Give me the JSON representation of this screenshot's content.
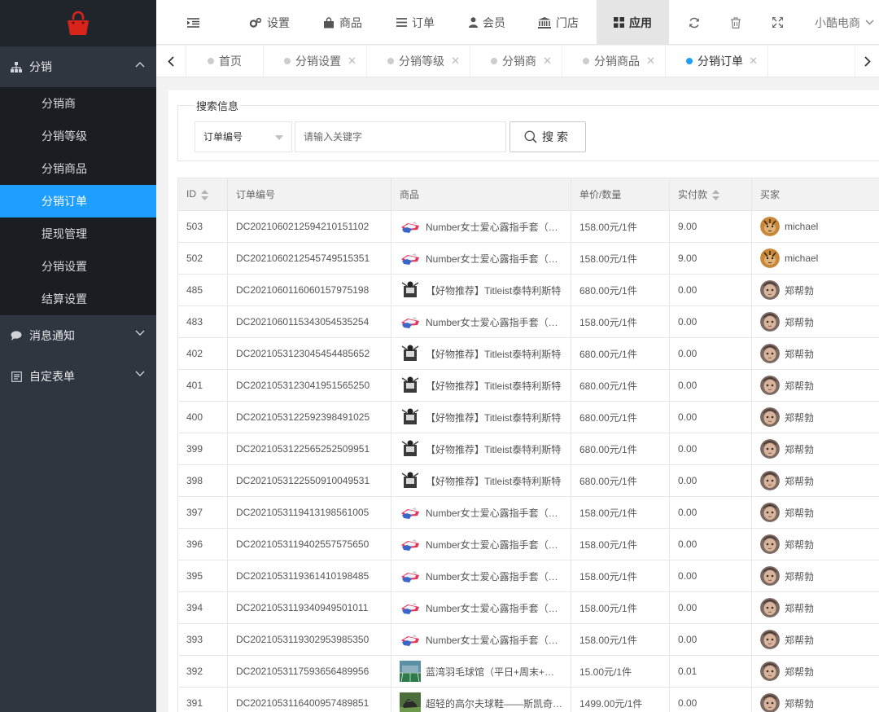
{
  "sidebar": {
    "groups": [
      {
        "label": "分销",
        "icon": "sitemap-icon",
        "expanded": true
      },
      {
        "label": "消息通知",
        "icon": "comment-icon",
        "expanded": false
      },
      {
        "label": "自定表单",
        "icon": "form-icon",
        "expanded": false
      }
    ],
    "items": [
      "分销商",
      "分销等级",
      "分销商品",
      "分销订单",
      "提现管理",
      "分销设置",
      "结算设置"
    ],
    "active_item": "分销订单"
  },
  "topnav": {
    "items": [
      {
        "label": "设置",
        "icon": "gears-icon"
      },
      {
        "label": "商品",
        "icon": "bag-icon"
      },
      {
        "label": "订单",
        "icon": "list-icon"
      },
      {
        "label": "会员",
        "icon": "user-icon"
      },
      {
        "label": "门店",
        "icon": "bank-icon"
      },
      {
        "label": "应用",
        "icon": "grid-icon"
      }
    ],
    "active": "应用",
    "shop_name": "小酷电商"
  },
  "tabs": [
    {
      "label": "首页",
      "closable": false
    },
    {
      "label": "分销设置",
      "closable": true
    },
    {
      "label": "分销等级",
      "closable": true
    },
    {
      "label": "分销商",
      "closable": true
    },
    {
      "label": "分销商品",
      "closable": true
    },
    {
      "label": "分销订单",
      "closable": true,
      "active": true
    }
  ],
  "search": {
    "legend": "搜索信息",
    "select_value": "订单编号",
    "keyword_placeholder": "请输入关键字",
    "button_label": "搜 索"
  },
  "table": {
    "headers": {
      "id": "ID",
      "order_no": "订单编号",
      "goods": "商品",
      "price_qty": "单价/数量",
      "paid": "实付款",
      "buyer": "买家"
    },
    "rows": [
      {
        "id": "503",
        "order_no": "DC20210602125942101511 02",
        "goods": "Number女士爱心露指手套（…",
        "thumb": "glove",
        "price_qty": "158.00元 / 1件",
        "paid": "9.00",
        "buyer": "michael",
        "avatar": "tiger"
      },
      {
        "id": "502",
        "order_no": "DC20210602125457495153 51",
        "goods": "Number女士爱心露指手套（…",
        "thumb": "glove",
        "price_qty": "158.00元 / 1件",
        "paid": "9.00",
        "buyer": "michael",
        "avatar": "tiger"
      },
      {
        "id": "485",
        "order_no": "DC20210601160601579751 98",
        "goods": "【好物推荐】Titleist泰特利斯特",
        "thumb": "golf",
        "price_qty": "680.00元 / 1件",
        "paid": "0.00",
        "buyer": "郑帮勃",
        "avatar": "face"
      },
      {
        "id": "483",
        "order_no": "DC20210601153430545352 54",
        "goods": "Number女士爱心露指手套（…",
        "thumb": "glove",
        "price_qty": "158.00元 / 1件",
        "paid": "0.00",
        "buyer": "郑帮勃",
        "avatar": "face"
      },
      {
        "id": "402",
        "order_no": "DC20210531230454544856 52",
        "goods": "【好物推荐】Titleist泰特利斯特",
        "thumb": "golf",
        "price_qty": "680.00元 / 1件",
        "paid": "0.00",
        "buyer": "郑帮勃",
        "avatar": "face"
      },
      {
        "id": "401",
        "order_no": "DC20210531230419515652 50",
        "goods": "【好物推荐】Titleist泰特利斯特",
        "thumb": "golf",
        "price_qty": "680.00元 / 1件",
        "paid": "0.00",
        "buyer": "郑帮勃",
        "avatar": "face"
      },
      {
        "id": "400",
        "order_no": "DC20210531225923984910 25",
        "goods": "【好物推荐】Titleist泰特利斯特",
        "thumb": "golf",
        "price_qty": "680.00元 / 1件",
        "paid": "0.00",
        "buyer": "郑帮勃",
        "avatar": "face"
      },
      {
        "id": "399",
        "order_no": "DC20210531225652525099 51",
        "goods": "【好物推荐】Titleist泰特利斯特",
        "thumb": "golf",
        "price_qty": "680.00元 / 1件",
        "paid": "0.00",
        "buyer": "郑帮勃",
        "avatar": "face"
      },
      {
        "id": "398",
        "order_no": "DC20210531225509100495 31",
        "goods": "【好物推荐】Titleist泰特利斯特",
        "thumb": "golf",
        "price_qty": "680.00元 / 1件",
        "paid": "0.00",
        "buyer": "郑帮勃",
        "avatar": "face"
      },
      {
        "id": "397",
        "order_no": "DC20210531194131985610 05",
        "goods": "Number女士爱心露指手套（…",
        "thumb": "glove",
        "price_qty": "158.00元 / 1件",
        "paid": "0.00",
        "buyer": "郑帮勃",
        "avatar": "face"
      },
      {
        "id": "396",
        "order_no": "DC20210531194025575756 50",
        "goods": "Number女士爱心露指手套（…",
        "thumb": "glove",
        "price_qty": "158.00元 / 1件",
        "paid": "0.00",
        "buyer": "郑帮勃",
        "avatar": "face"
      },
      {
        "id": "395",
        "order_no": "DC20210531193614101984 85",
        "goods": "Number女士爱心露指手套（…",
        "thumb": "glove",
        "price_qty": "158.00元 / 1件",
        "paid": "0.00",
        "buyer": "郑帮勃",
        "avatar": "face"
      },
      {
        "id": "394",
        "order_no": "DC20210531193409495010 11",
        "goods": "Number女士爱心露指手套（…",
        "thumb": "glove",
        "price_qty": "158.00元 / 1件",
        "paid": "0.00",
        "buyer": "郑帮勃",
        "avatar": "face"
      },
      {
        "id": "393",
        "order_no": "DC20210531193029539853 50",
        "goods": "Number女士爱心露指手套（…",
        "thumb": "glove",
        "price_qty": "158.00元 / 1件",
        "paid": "0.00",
        "buyer": "郑帮勃",
        "avatar": "face"
      },
      {
        "id": "392",
        "order_no": "DC20210531175936564899 56",
        "goods": "蓝湾羽毛球馆（平日+周末+…",
        "thumb": "court",
        "price_qty": "15.00元 / 1件",
        "paid": "0.01",
        "buyer": "郑帮勃",
        "avatar": "face"
      },
      {
        "id": "391",
        "order_no": "DC20210531164009574898 51",
        "goods": "超轻的高尔夫球鞋——斯凯奇…",
        "thumb": "shoe",
        "price_qty": "1499.00元 / 1件",
        "paid": "0.00",
        "buyer": "郑帮勃",
        "avatar": "face"
      }
    ]
  },
  "colors": {
    "accent": "#1e9fff",
    "sidebar": "#2f3640",
    "logo": "#d9241b"
  }
}
